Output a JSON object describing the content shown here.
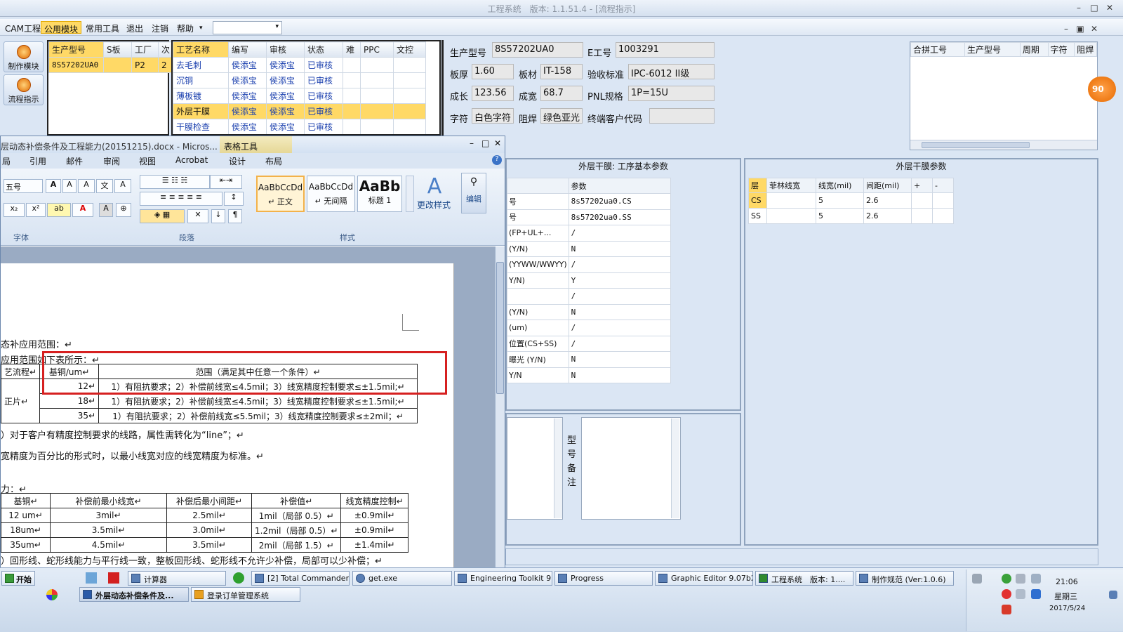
{
  "window": {
    "title": "工程系统　版本: 1.1.51.4 - [流程指示]",
    "min": "–",
    "max": "□",
    "close": "✕",
    "inner_min": "–",
    "inner_restore": "▣",
    "inner_close": "✕"
  },
  "menu": [
    "CAM工程",
    "公用模块",
    "常用工具",
    "退出",
    "注销",
    "帮助"
  ],
  "menu_arrow": "▾",
  "modules": [
    "制作模块",
    "流程指示"
  ],
  "left_grid": {
    "headers": [
      "生产型号",
      "S板",
      "工厂",
      "次"
    ],
    "rows": [
      [
        "8S57202UA0",
        "",
        "P2",
        "2"
      ]
    ]
  },
  "process_grid": {
    "headers": [
      "工艺名称",
      "编写",
      "审核",
      "状态",
      "难",
      "PPC",
      "文控"
    ],
    "rows": [
      [
        "去毛刺",
        "侯添宝",
        "侯添宝",
        "已审核"
      ],
      [
        "沉铜",
        "侯添宝",
        "侯添宝",
        "已审核"
      ],
      [
        "薄板镀",
        "侯添宝",
        "侯添宝",
        "已审核"
      ],
      [
        "外层干膜",
        "侯添宝",
        "侯添宝",
        "已审核"
      ],
      [
        "干膜检查",
        "侯添宝",
        "侯添宝",
        "已审核"
      ]
    ]
  },
  "form": {
    "prod_label": "生产型号",
    "prod_value": "8S57202UA0",
    "e_label": "E工号",
    "e_value": "1003291",
    "thick_label": "板厚",
    "thick_value": "1.60",
    "mat_label": "板材",
    "mat_value": "IT-158",
    "std_label": "验收标准",
    "std_value": "IPC-6012 II级",
    "len_label": "成长",
    "len_value": "123.56",
    "wid_label": "成宽",
    "wid_value": "68.7",
    "pnl_label": "PNL规格",
    "pnl_value": "1P=15U",
    "char_label": "字符",
    "char_value": "白色字符",
    "mask_label": "阻焊",
    "mask_value": "绿色亚光",
    "cust_label": "终端客户代码",
    "cust_value": ""
  },
  "right_grid": {
    "headers": [
      "合拼工号",
      "生产型号",
      "周期",
      "字符",
      "阻焊"
    ]
  },
  "orange_badge": "90",
  "basic_panel": {
    "title": "外层干膜: 工序基本参数",
    "param_header": "参数",
    "rows": [
      [
        "号",
        "8s57202ua0.CS"
      ],
      [
        "号",
        "8s57202ua0.SS"
      ],
      [
        "(FP+UL+...",
        "/"
      ],
      [
        "(Y/N)",
        "N"
      ],
      [
        "(YYWW/WWYY)",
        "/"
      ],
      [
        "Y/N)",
        "Y"
      ],
      [
        "",
        "/"
      ],
      [
        "(Y/N)",
        "N"
      ],
      [
        "(um)",
        "/"
      ],
      [
        "位置(CS+SS)",
        "/"
      ],
      [
        "曝光 (Y/N)",
        "N"
      ],
      [
        "Y/N",
        "N"
      ]
    ]
  },
  "film_panel": {
    "title": "外层干膜参数",
    "headers": [
      "层",
      "菲林线宽",
      "线宽(mil)",
      "间距(mil)",
      "+",
      "-"
    ],
    "rows": [
      [
        "CS",
        "",
        "5",
        "2.6"
      ],
      [
        "SS",
        "",
        "5",
        "2.6"
      ]
    ]
  },
  "remark_label": [
    "型",
    "号",
    "备",
    "注"
  ],
  "word": {
    "title": "层动态补偿条件及工程能力(20151215).docx - Micros...",
    "context_tab": "表格工具",
    "tabs": [
      "局",
      "引用",
      "邮件",
      "审阅",
      "视图",
      "Acrobat",
      "设计",
      "布局"
    ],
    "font_size": "五号",
    "styles": [
      {
        "preview": "AaBbCcDd",
        "name": "↵ 正文"
      },
      {
        "preview": "AaBbCcDd",
        "name": "↵ 无间隔"
      },
      {
        "preview": "AaBb",
        "name": "标题 1"
      }
    ],
    "change_style": "更改样式",
    "edit": "编辑",
    "groups": [
      "字体",
      "段落",
      "样式"
    ],
    "doc": {
      "line1": "态补应用范围：↵",
      "line2": "应用范围如下表所示：↵",
      "t1_head": [
        "艺流程↵",
        "基铜/um↵",
        "范围（满足其中任意一个条件）↵"
      ],
      "t1_side": "正片↵",
      "t1_rows": [
        [
          "12↵",
          "1）有阻抗要求；2）补偿前线宽≤4.5mil；3）线宽精度控制要求≤±1.5mil;↵"
        ],
        [
          "18↵",
          "1）有阻抗要求；2）补偿前线宽≤4.5mil；3）线宽精度控制要求≤±1.5mil;↵"
        ],
        [
          "35↵",
          "1）有阻抗要求；2）补偿前线宽≤5.5mil；3）线宽精度控制要求≤±2mil；↵"
        ]
      ],
      "line3": "）对于客户有精度控制要求的线路，属性需转化为“line”；↵",
      "line4": "宽精度为百分比的形式时，以最小线宽对应的线宽精度为标准。↵",
      "line5": "力：↵",
      "t2_head": [
        "基铜↵",
        "补偿前最小线宽↵",
        "补偿后最小间距↵",
        "补偿值↵",
        "线宽精度控制↵"
      ],
      "t2_rows": [
        [
          "12 um↵",
          "3mil↵",
          "2.5mil↵",
          "1mil（局部 0.5）↵",
          "±0.9mil↵"
        ],
        [
          "18um↵",
          "3.5mil↵",
          "3.0mil↵",
          "1.2mil（局部 0.5）↵",
          "±0.9mil↵"
        ],
        [
          "35um↵",
          "4.5mil↵",
          "3.5mil↵",
          "2mil（局部 1.5）↵",
          "±1.4mil↵"
        ]
      ],
      "line6": "）回形线、蛇形线能力与平行线一致，整板回形线、蛇形线不允许少补偿，局部可以少补偿；↵"
    }
  },
  "taskbar": {
    "start": "开始",
    "row1": [
      "计算器",
      "[2] Total Commander ...",
      "get.exe",
      "Engineering Toolkit 9....",
      "Progress",
      "Graphic Editor 9.07b2...",
      "工程系统　版本: 1....",
      "制作规范 (Ver:1.0.6)"
    ],
    "row2": [
      "外层动态补偿条件及...",
      "登录订单管理系统"
    ],
    "time": "21:06",
    "weekday": "星期三",
    "date": "2017/5/24"
  }
}
